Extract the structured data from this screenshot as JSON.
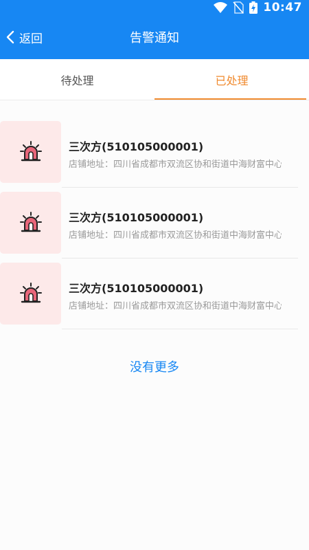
{
  "status_bar": {
    "time": "10:47",
    "icons": [
      "wifi-icon",
      "no-sim-icon",
      "battery-charging-icon"
    ]
  },
  "header": {
    "back_label": "返回",
    "title": "告警通知",
    "back_icon": "chevron-left-icon"
  },
  "tabs": [
    {
      "label": "待处理",
      "active": false
    },
    {
      "label": "已处理",
      "active": true
    }
  ],
  "alerts": [
    {
      "title": "三次方(510105000001)",
      "address": "店铺地址：四川省成都市双流区协和街道中海财富中心",
      "icon": "alarm-light-icon"
    },
    {
      "title": "三次方(510105000001)",
      "address": "店铺地址：四川省成都市双流区协和街道中海财富中心",
      "icon": "alarm-light-icon"
    },
    {
      "title": "三次方(510105000001)",
      "address": "店铺地址：四川省成都市双流区协和街道中海财富中心",
      "icon": "alarm-light-icon"
    }
  ],
  "footer": {
    "no_more_text": "没有更多"
  },
  "colors": {
    "primary": "#1787f3",
    "tab_active": "#f08a2e",
    "icon_bg": "#fde9e9",
    "alarm": "#e8667a"
  }
}
